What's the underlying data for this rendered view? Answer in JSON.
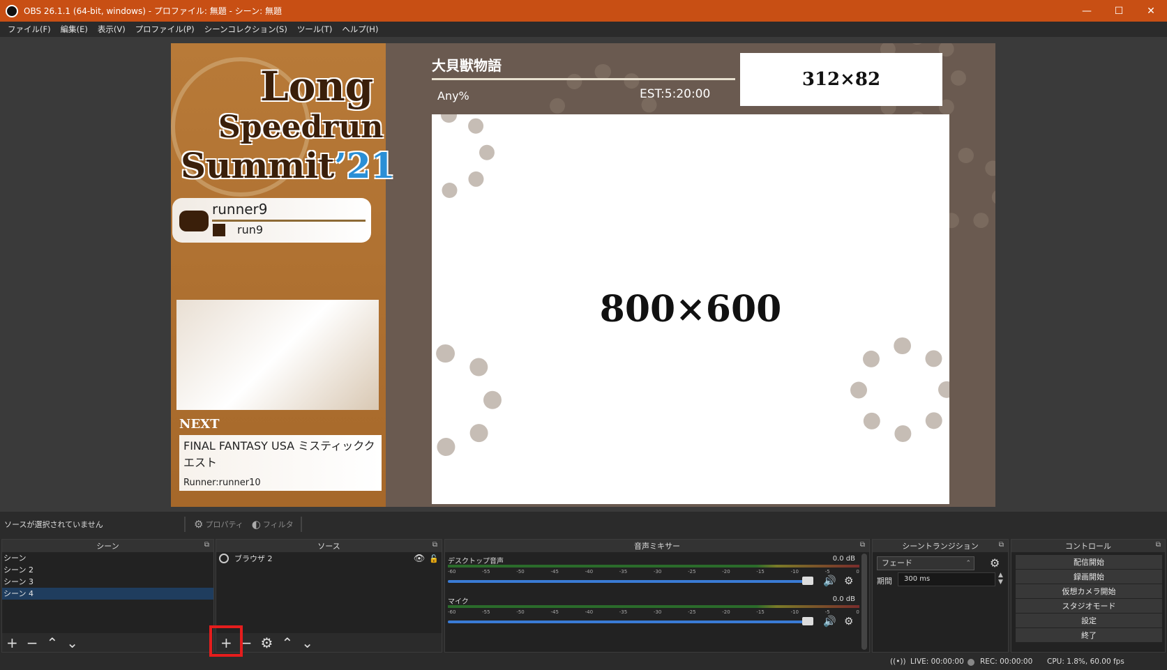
{
  "window": {
    "title": "OBS 26.1.1 (64-bit, windows) - プロファイル: 無題 - シーン: 無題"
  },
  "menu": [
    "ファイル(F)",
    "編集(E)",
    "表示(V)",
    "プロファイル(P)",
    "シーンコレクション(S)",
    "ツール(T)",
    "ヘルプ(H)"
  ],
  "preview": {
    "logo": {
      "line1": "Long",
      "line2": "Speedrun",
      "line3": "Summit",
      "year": "’21"
    },
    "runner": {
      "name": "runner9",
      "twitch": "run9"
    },
    "next_label": "NEXT",
    "next_game": "FINAL FANTASY USA ミスティッククエスト",
    "next_runner": "Runner:runner10",
    "game_title": "大貝獣物語",
    "category": "Any%",
    "estimate": "EST:5:20:00",
    "small_box": "312×82",
    "big_box": "800×600"
  },
  "status_row": {
    "no_source": "ソースが選択されていません",
    "properties": "プロパティ",
    "filters": "フィルタ"
  },
  "docks": {
    "scenes": {
      "title": "シーン",
      "items": [
        "シーン",
        "シーン 2",
        "シーン 3",
        "シーン 4"
      ],
      "selected": 3
    },
    "sources": {
      "title": "ソース",
      "items": [
        {
          "name": "ブラウザ 2"
        }
      ]
    },
    "mixer": {
      "title": "音声ミキサー",
      "tracks": [
        {
          "name": "デスクトップ音声",
          "db": "0.0 dB"
        },
        {
          "name": "マイク",
          "db": "0.0 dB"
        }
      ],
      "scale": [
        "-60",
        "-55",
        "-50",
        "-45",
        "-40",
        "-35",
        "-30",
        "-25",
        "-20",
        "-15",
        "-10",
        "-5",
        "0"
      ]
    },
    "transitions": {
      "title": "シーントランジション",
      "selected": "フェード",
      "duration_label": "期間",
      "duration": "300 ms"
    },
    "controls": {
      "title": "コントロール",
      "buttons": [
        "配信開始",
        "録画開始",
        "仮想カメラ開始",
        "スタジオモード",
        "設定",
        "終了"
      ]
    }
  },
  "statusbar": {
    "live": "LIVE: 00:00:00",
    "rec": "REC: 00:00:00",
    "cpu": "CPU: 1.8%, 60.00 fps"
  },
  "colors": {
    "titlebar": "#c84f14",
    "highlight": "#e51d1d",
    "selection": "#1f3d5e"
  }
}
